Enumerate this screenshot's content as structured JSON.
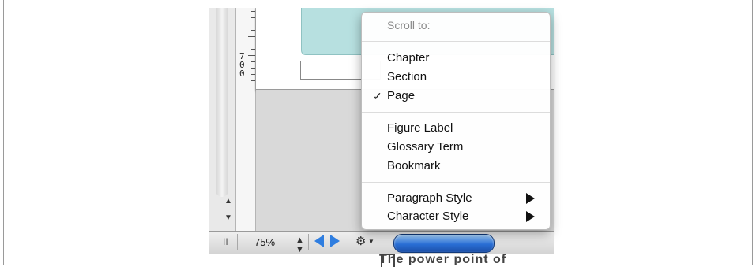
{
  "ruler": {
    "digits": [
      "7",
      "0",
      "0"
    ]
  },
  "statusbar": {
    "pause_icon": "pause-icon",
    "zoom": "75%",
    "zoom_stepper": "up-down-arrows-icon",
    "prev_icon": "previous-page-icon",
    "next_icon": "next-page-icon",
    "gear_icon": "gear-icon",
    "accent": "#2f7ee0"
  },
  "context_menu": {
    "header": "Scroll to:",
    "group1": [
      {
        "label": "Chapter",
        "checked": false
      },
      {
        "label": "Section",
        "checked": false
      },
      {
        "label": "Page",
        "checked": true
      }
    ],
    "group2": [
      {
        "label": "Figure Label"
      },
      {
        "label": "Glossary Term"
      },
      {
        "label": "Bookmark"
      }
    ],
    "group3": [
      {
        "label": "Paragraph Style",
        "has_submenu": true
      },
      {
        "label": "Character Style",
        "has_submenu": true
      }
    ],
    "checkmark": "✓"
  },
  "background_text": "The power point of"
}
